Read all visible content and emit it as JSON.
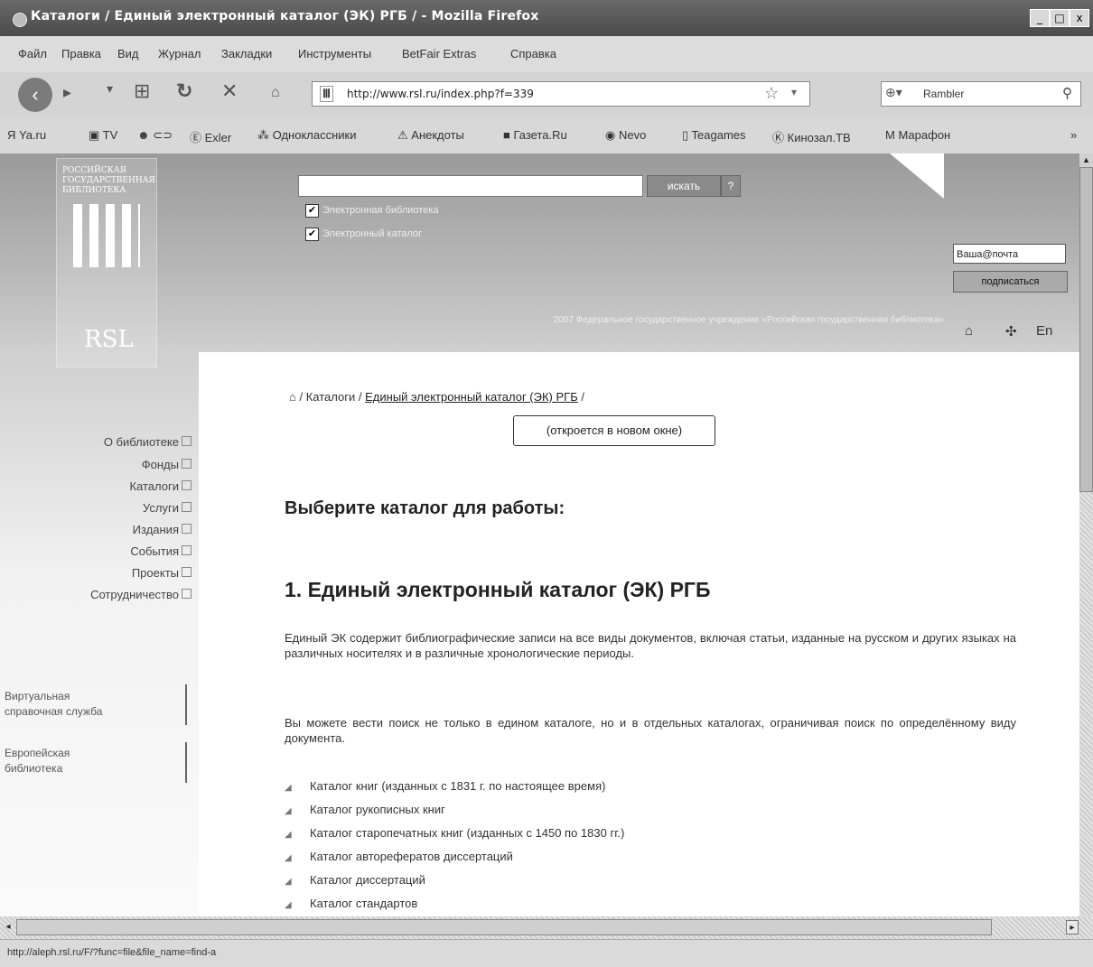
{
  "window": {
    "title": "Каталоги / Единый электронный каталог (ЭК) РГБ / - Mozilla Firefox",
    "controls": [
      "_",
      "□",
      "x"
    ]
  },
  "menu": [
    "Файл",
    "Правка",
    "Вид",
    "Журнал",
    "Закладки",
    "Инструменты",
    "BetFair Extras",
    "Справка"
  ],
  "nav": {
    "url": "http://www.rsl.ru/index.php?f=339",
    "search_engine": "Rambler"
  },
  "bookmarks": [
    "Ya.ru",
    "TV",
    "Exler",
    "Одноклассники",
    "Анекдоты",
    "Газета.Ru",
    "Nevo",
    "Teagames",
    "Кинозал.ТВ",
    "Марафон",
    "»"
  ],
  "site": {
    "logo_text": "РОССИЙСКАЯ ГОСУДАРСТВЕННАЯ БИБЛИОТЕКА",
    "logo_mark": "RSL",
    "search_button": "искать",
    "help_button": "?",
    "checkbox_1": "Электронная библиотека",
    "checkbox_2": "Электронный каталог",
    "email_placeholder": "Ваша@почта",
    "subscribe_button": "подписаться",
    "tagline": "2007 Федеральное государственное учреждение «Российская государственная библиотека»",
    "lang": "En"
  },
  "breadcrumb": {
    "sep1": "/",
    "catalogs": "Каталоги",
    "sep2": "/",
    "current": "Единый электронный каталог (ЭК) РГБ",
    "sep3": "/"
  },
  "new_window_note": "(откроется в новом окне)",
  "sidebar": {
    "menu": [
      "О библиотеке",
      "Фонды",
      "Каталоги",
      "Услуги",
      "Издания",
      "События",
      "Проекты",
      "Сотрудничество"
    ],
    "box_1": [
      "Виртуальная",
      "справочная служба"
    ],
    "box_2": [
      "Европейская",
      "библиотека"
    ]
  },
  "content": {
    "choose_heading": "Выберите каталог для работы:",
    "section_heading": "1. Единый электронный каталог (ЭК) РГБ",
    "para_1": "Единый ЭК содержит библиографические записи на все виды документов, включая статьи, изданные на русском и других языках на различных носителях и в различные хронологические периоды.",
    "para_2": "Вы можете вести поиск не только в едином каталоге, но и в отдельных каталогах, ограничивая поиск по определённому виду документа.",
    "catalog_list": [
      "Каталог книг (изданных с 1831 г. по настоящее время)",
      "Каталог рукописных книг",
      "Каталог старопечатных книг (изданных с 1450 по 1830 гг.)",
      "Каталог авторефератов диссертаций",
      "Каталог диссертаций",
      "Каталог стандартов"
    ]
  },
  "status_bar": "http://aleph.rsl.ru/F/?func=file&file_name=find-a"
}
